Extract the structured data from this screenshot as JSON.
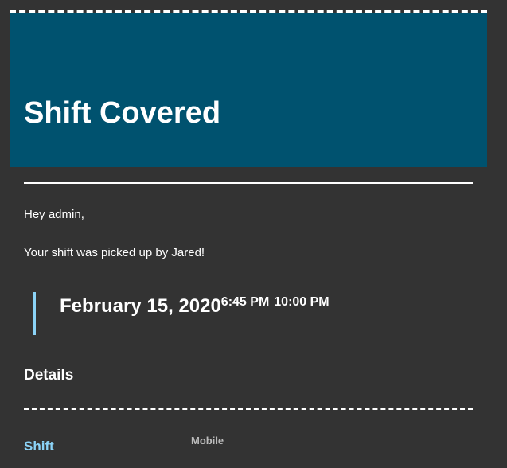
{
  "header": {
    "title": "Shift Covered"
  },
  "body": {
    "greeting": "Hey admin,",
    "message": "Your shift was picked up by Jared!"
  },
  "shift": {
    "date": "February 15, 2020",
    "start_time": "6:45 PM",
    "end_time": "10:00 PM"
  },
  "details": {
    "title": "Details",
    "rows": [
      {
        "label": "Shift",
        "value": "Mobile"
      }
    ]
  },
  "colors": {
    "background": "#333333",
    "header_bg": "#00526f",
    "accent": "#8bd3f7",
    "text": "#ffffff"
  }
}
